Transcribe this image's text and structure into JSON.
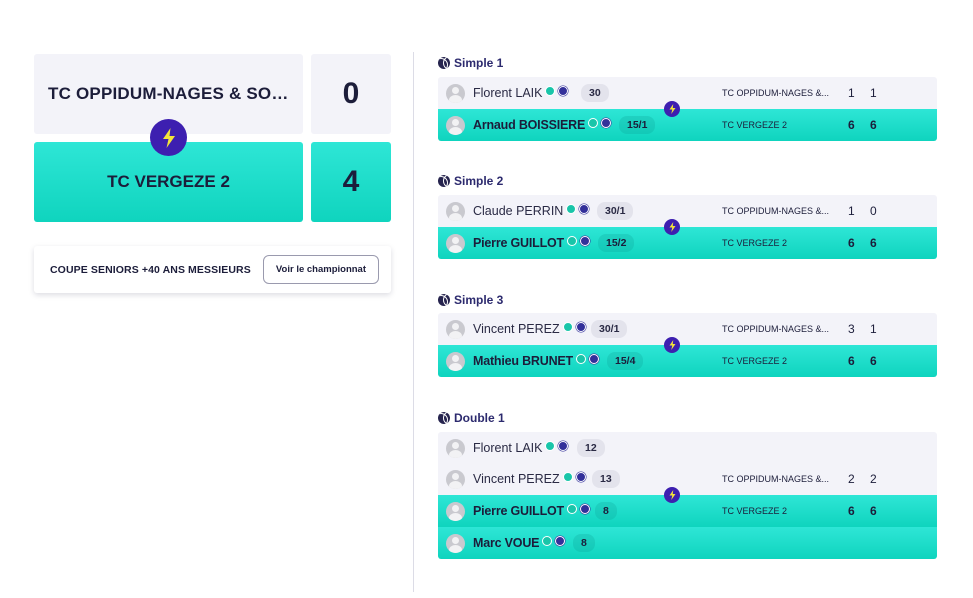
{
  "score_card": {
    "home_team": "TC OPPIDUM-NAGES & SOL...",
    "home_score": "0",
    "away_team": "TC VERGEZE 2",
    "away_score": "4"
  },
  "competition": {
    "title": "COUPE SENIORS +40 ANS MESSIEURS",
    "button_label": "Voir le championnat"
  },
  "icons": {
    "winner": "lightning-bolt-icon",
    "match_type": "tennis-ball-icon",
    "player": "avatar-placeholder",
    "badges": [
      "green-badge-icon",
      "blue-badge-icon"
    ]
  },
  "colors": {
    "accent_teal": "#0fd4be",
    "bolt_purple": "#3d1fb0",
    "loser_bg": "#f3f3f9",
    "text_dark": "#1c1d3a"
  },
  "matches": [
    {
      "title": "Simple 1",
      "home": {
        "players": [
          {
            "name": "Florent LAIK",
            "rank": "30"
          }
        ],
        "team": "TC OPPIDUM-NAGES &...",
        "sets": "1 1"
      },
      "away": {
        "players": [
          {
            "name": "Arnaud BOISSIERE",
            "rank": "15/1"
          }
        ],
        "team": "TC VERGEZE 2",
        "sets": "6 6"
      }
    },
    {
      "title": "Simple 2",
      "home": {
        "players": [
          {
            "name": "Claude PERRIN",
            "rank": "30/1"
          }
        ],
        "team": "TC OPPIDUM-NAGES &...",
        "sets": "1 0"
      },
      "away": {
        "players": [
          {
            "name": "Pierre GUILLOT",
            "rank": "15/2"
          }
        ],
        "team": "TC VERGEZE 2",
        "sets": "6 6"
      }
    },
    {
      "title": "Simple 3",
      "home": {
        "players": [
          {
            "name": "Vincent PEREZ",
            "rank": "30/1"
          }
        ],
        "team": "TC OPPIDUM-NAGES &...",
        "sets": "3 1"
      },
      "away": {
        "players": [
          {
            "name": "Mathieu BRUNET",
            "rank": "15/4"
          }
        ],
        "team": "TC VERGEZE 2",
        "sets": "6 6"
      }
    },
    {
      "title": "Double 1",
      "home": {
        "players": [
          {
            "name": "Florent LAIK",
            "rank": "12"
          },
          {
            "name": "Vincent PEREZ",
            "rank": "13"
          }
        ],
        "team": "TC OPPIDUM-NAGES &...",
        "sets": "2 2"
      },
      "away": {
        "players": [
          {
            "name": "Pierre GUILLOT",
            "rank": "8"
          },
          {
            "name": "Marc VOUE",
            "rank": "8"
          }
        ],
        "team": "TC VERGEZE 2",
        "sets": "6 6"
      }
    }
  ]
}
